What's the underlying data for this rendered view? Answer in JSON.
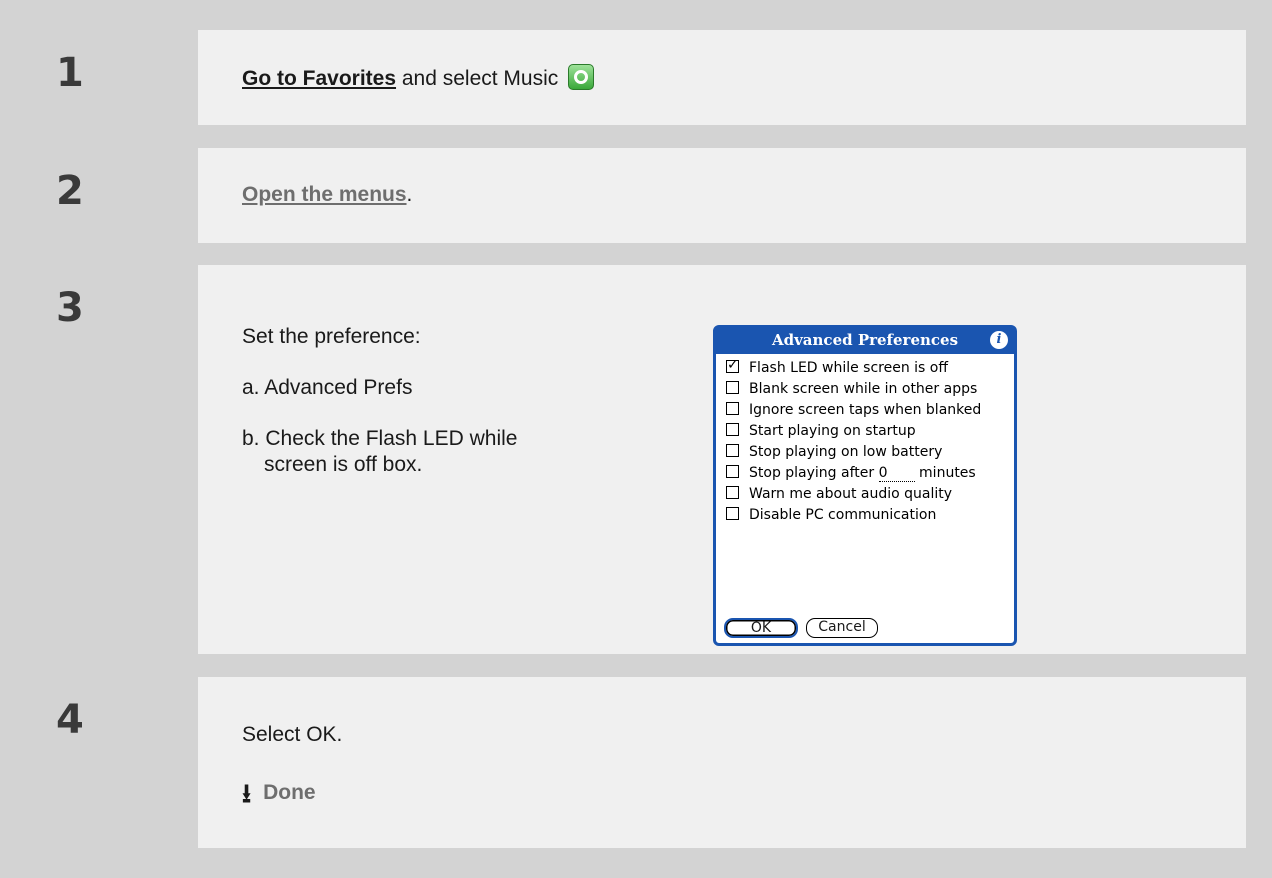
{
  "steps": [
    {
      "number": "1",
      "link": "Go to Favorites",
      "text": " and select Music"
    },
    {
      "number": "2",
      "link": "Open the menus",
      "text": "."
    },
    {
      "number": "3",
      "intro": "Set the preference:",
      "a": "a.  Advanced Prefs",
      "b1": "b.  Check the Flash LED while",
      "b2": "screen is off box."
    },
    {
      "number": "4",
      "text": "Select OK.",
      "done": "Done"
    }
  ],
  "dialog": {
    "title": "Advanced Preferences",
    "options": [
      {
        "label": "Flash LED while screen is off",
        "checked": true
      },
      {
        "label": "Blank screen while in other apps",
        "checked": false
      },
      {
        "label": "Ignore screen taps when blanked",
        "checked": false
      },
      {
        "label": "Start playing on startup",
        "checked": false
      },
      {
        "label": "Stop playing on low battery",
        "checked": false
      },
      {
        "label": "Stop playing after",
        "checked": false,
        "value": "0",
        "suffix": "minutes"
      },
      {
        "label": "Warn me about audio quality",
        "checked": false
      },
      {
        "label": "Disable PC communication",
        "checked": false
      }
    ],
    "ok_label": "OK",
    "cancel_label": "Cancel"
  },
  "icons": {
    "music": "music-app-icon",
    "info": "info-icon",
    "done": "down-arrow-icon"
  },
  "colors": {
    "background": "#d3d3d3",
    "panel": "#f0f0f0",
    "dialog_blue": "#1a55b0",
    "link_gray": "#6e6e6e"
  }
}
